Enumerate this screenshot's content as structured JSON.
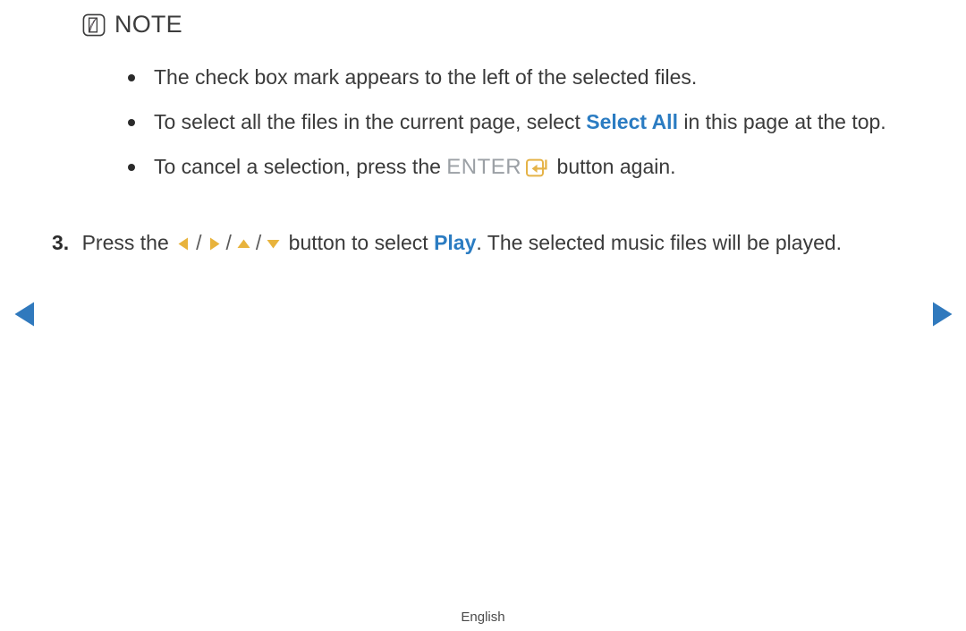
{
  "note": {
    "icon": "note-pen-icon",
    "title": "NOTE"
  },
  "bullets": [
    {
      "id": "bullet-checkbox-mark",
      "marker": "bullet-dot",
      "text_before": "The check box mark appears to the left of the selected files.",
      "highlight": "",
      "text_after": ""
    },
    {
      "id": "bullet-select-all",
      "marker": "bullet-dot",
      "text_before": "To select all the files in the current page, select ",
      "highlight": "Select All",
      "text_after": " in this page at the top."
    },
    {
      "id": "bullet-cancel-selection",
      "marker": "bullet-dot",
      "text_before": "To cancel a selection, press the ",
      "enter_label": "ENTER",
      "enter_icon": "enter-key-icon",
      "text_after": " button again."
    }
  ],
  "step": {
    "number": "3.",
    "text_before": "Press the ",
    "arrows": [
      {
        "name": "arrow-left-icon",
        "dir": "left"
      },
      {
        "name": "arrow-right-icon",
        "dir": "right"
      },
      {
        "name": "arrow-up-icon",
        "dir": "up"
      },
      {
        "name": "arrow-down-icon",
        "dir": "down"
      }
    ],
    "separator": "/",
    "text_middle": " button to select ",
    "highlight": "Play",
    "text_after": ". The selected music files will be played."
  },
  "navigation": {
    "prev": "previous-page-arrow",
    "next": "next-page-arrow"
  },
  "footer": {
    "language": "English"
  },
  "colors": {
    "accent_blue": "#2b7cc2",
    "nav_blue": "#3079bd",
    "accent_gold": "#e8b33c",
    "enter_gray": "#9ba0a5",
    "body_text": "#3a3a3a",
    "background": "#ffffff"
  }
}
